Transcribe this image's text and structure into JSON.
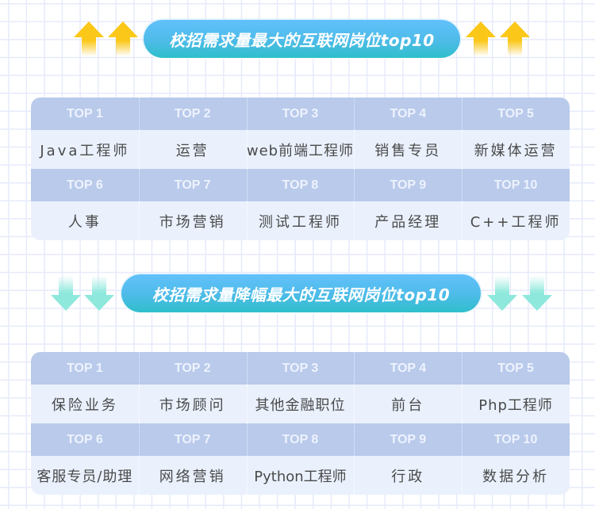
{
  "sections": [
    {
      "title": "校招需求量最大的互联网岗位top10",
      "arrow_direction": "up",
      "arrow_color": "#fbc819",
      "ranks": [
        "TOP 1",
        "TOP 2",
        "TOP 3",
        "TOP 4",
        "TOP 5",
        "TOP 6",
        "TOP 7",
        "TOP 8",
        "TOP 9",
        "TOP 10"
      ],
      "jobs": [
        "Java工程师",
        "运营",
        "web前端工程师",
        "销售专员",
        "新媒体运营",
        "人事",
        "市场营销",
        "测试工程师",
        "产品经理",
        "C++工程师"
      ]
    },
    {
      "title": "校招需求量降幅最大的互联网岗位top10",
      "arrow_direction": "down",
      "arrow_color": "#8ee8dc",
      "ranks": [
        "TOP 1",
        "TOP 2",
        "TOP 3",
        "TOP 4",
        "TOP 5",
        "TOP 6",
        "TOP 7",
        "TOP 8",
        "TOP 9",
        "TOP 10"
      ],
      "jobs": [
        "保险业务",
        "市场顾问",
        "其他金融职位",
        "前台",
        "Php工程师",
        "客服专员/助理",
        "网络营销",
        "Python工程师",
        "行政",
        "数据分析"
      ]
    }
  ],
  "colors": {
    "pill_top": "#62c1fb",
    "pill_bottom": "#2fbfcb",
    "table_header_bg": "#b9caeb",
    "table_body_bg": "#eaf1fd",
    "cell_text": "#4a4a4a"
  }
}
